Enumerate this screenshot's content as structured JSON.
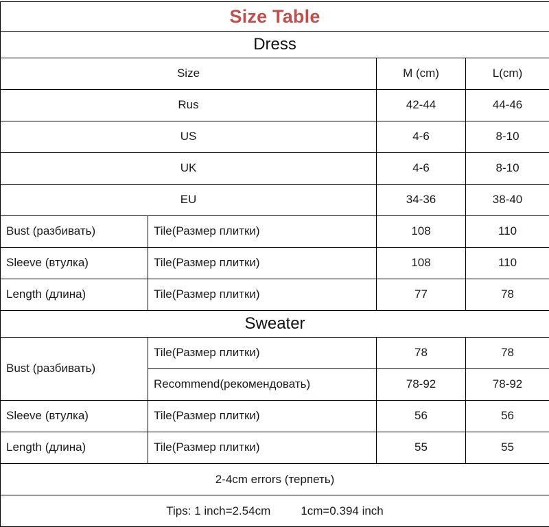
{
  "title": "Size Table",
  "title_color": "#c0504d",
  "columns": {
    "measure_header": "",
    "type_header": "",
    "m": "M (cm)",
    "l": "L(cm)"
  },
  "sections": [
    {
      "name": "Dress",
      "size_rows": [
        {
          "label": "Size",
          "m": "M (cm)",
          "l": "L(cm)"
        },
        {
          "label": "Rus",
          "m": "42-44",
          "l": "44-46"
        },
        {
          "label": "US",
          "m": "4-6",
          "l": "8-10"
        },
        {
          "label": "UK",
          "m": "4-6",
          "l": "8-10"
        },
        {
          "label": "EU",
          "m": "34-36",
          "l": "38-40"
        }
      ],
      "measure_rows": [
        {
          "measure": "Bust (разбивать)",
          "type": "Tile(Размер плитки)",
          "m": "108",
          "l": "110"
        },
        {
          "measure": "Sleeve (втулка)",
          "type": "Tile(Размер плитки)",
          "m": "108",
          "l": "110"
        },
        {
          "measure": "Length (длина)",
          "type": "Tile(Размер плитки)",
          "m": "77",
          "l": "78"
        }
      ]
    },
    {
      "name": "Sweater",
      "bust_label": "Bust (разбивать)",
      "bust_rows": [
        {
          "type": "Tile(Размер плитки)",
          "m": "78",
          "l": "78"
        },
        {
          "type": "Recommend(рекомендовать)",
          "m": "78-92",
          "l": "78-92"
        }
      ],
      "measure_rows": [
        {
          "measure": "Sleeve (втулка)",
          "type": "Tile(Размер плитки)",
          "m": "56",
          "l": "56"
        },
        {
          "measure": "Length (длина)",
          "type": "Tile(Размер плитки)",
          "m": "55",
          "l": "55"
        }
      ]
    }
  ],
  "footer": {
    "errors": "2-4cm errors (терпеть)",
    "tips_left": "Tips: 1 inch=2.54cm",
    "tips_right": "1cm=0.394 inch"
  }
}
